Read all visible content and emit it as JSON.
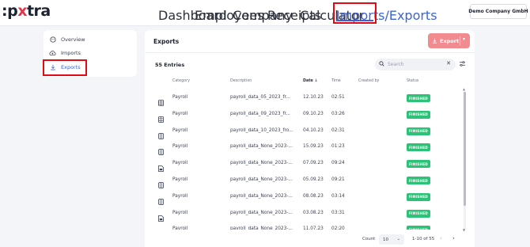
{
  "app": {
    "logo_prefix": ":p",
    "logo_x": "x",
    "logo_suffix": "tra"
  },
  "nav": {
    "items": [
      {
        "label": "Dashboard"
      },
      {
        "label": "Employees"
      },
      {
        "label": "Company"
      },
      {
        "label": "Receipts"
      },
      {
        "label": "Calculator"
      },
      {
        "label": "Imports/Exports"
      }
    ],
    "active": "Imports/Exports",
    "company": "Demo Company GmbH"
  },
  "sidebar": {
    "items": [
      {
        "label": "Overview",
        "icon": "overview-icon"
      },
      {
        "label": "Imports",
        "icon": "cloud-upload-icon"
      },
      {
        "label": "Exports",
        "icon": "download-icon"
      }
    ],
    "active": "Exports"
  },
  "main": {
    "title": "Exports",
    "export_button": "Export",
    "entries": "55 Entries",
    "search_placeholder": "Search",
    "columns": {
      "category": "Category",
      "description": "Description",
      "date": "Date",
      "time": "Time",
      "created_by": "Created by",
      "status": "Status"
    },
    "rows": [
      {
        "file": "sheet",
        "category": "Payroll",
        "description": "payroll_data_05_2023_fr...",
        "date": "12.10.23",
        "time": "02:51",
        "status": "FINISHED"
      },
      {
        "file": "sheet",
        "category": "Payroll",
        "description": "payroll_data_09_2023_fr...",
        "date": "09.10.23",
        "time": "03:26",
        "status": "FINISHED"
      },
      {
        "file": "doc",
        "category": "Payroll",
        "description": "payroll_data_10_2023_fro...",
        "date": "04.10.23",
        "time": "02:31",
        "status": "FINISHED"
      },
      {
        "file": "doc",
        "category": "Payroll",
        "description": "payroll_data_None_2023-...",
        "date": "15.09.23",
        "time": "01:23",
        "status": "FINISHED"
      },
      {
        "file": "pdf",
        "category": "Payroll",
        "description": "payroll_data_None_2023-...",
        "date": "07.09.23",
        "time": "09:24",
        "status": "FINISHED"
      },
      {
        "file": "doc",
        "category": "Payroll",
        "description": "payroll_data_None_2023-...",
        "date": "05.09.23",
        "time": "09:21",
        "status": "FINISHED"
      },
      {
        "file": "doc",
        "category": "Payroll",
        "description": "payroll_data_None_2023-...",
        "date": "08.08.23",
        "time": "03:14",
        "status": "FINISHED"
      },
      {
        "file": "pdf",
        "category": "Payroll",
        "description": "payroll_data_None_2023-...",
        "date": "03.08.23",
        "time": "03:31",
        "status": "FINISHED"
      },
      {
        "file": "doc",
        "category": "Payroll",
        "description": "payroll_data_None_2023-...",
        "date": "11.07.23",
        "time": "02:20",
        "status": "FINISHED"
      }
    ],
    "footer": {
      "count_label": "Count",
      "count_value": "10",
      "range": "1-10 of 55"
    }
  },
  "colors": {
    "accent": "#3d63d9",
    "brand_red": "#e1374a",
    "export_button": "#f28b8f",
    "finished_badge": "#2cc277",
    "highlight_box": "#e00b14"
  }
}
